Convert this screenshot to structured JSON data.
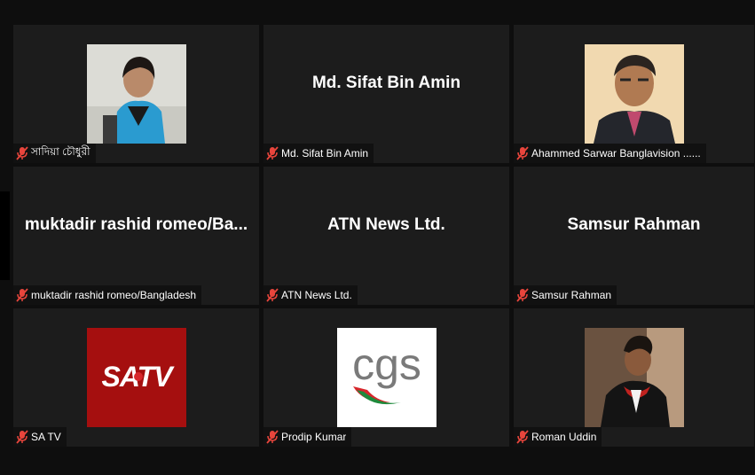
{
  "participants": [
    {
      "display": "",
      "label": "সাদিয়া চৌধুরী",
      "avatar": "photo-woman"
    },
    {
      "display": "Md. Sifat Bin Amin",
      "label": "Md. Sifat Bin Amin",
      "avatar": ""
    },
    {
      "display": "",
      "label": "Ahammed Sarwar Banglavision ......",
      "avatar": "photo-man"
    },
    {
      "display": "muktadir rashid romeo/Ba...",
      "label": "muktadir rashid romeo/Bangladesh",
      "avatar": ""
    },
    {
      "display": "ATN News Ltd.",
      "label": "ATN News Ltd.",
      "avatar": ""
    },
    {
      "display": "Samsur Rahman",
      "label": "Samsur Rahman",
      "avatar": ""
    },
    {
      "display": "",
      "label": "SA TV",
      "avatar": "satv-logo",
      "logo_text": "SATV"
    },
    {
      "display": "",
      "label": "Prodip Kumar",
      "avatar": "cgs-logo",
      "logo_text": "cgs"
    },
    {
      "display": "",
      "label": "Roman Uddin",
      "avatar": "photo-graduate"
    }
  ],
  "icons": {
    "muted": "mic-muted-icon"
  },
  "colors": {
    "muted": "#e8453c",
    "satv_bg": "#a50f0f",
    "cgs_red": "#d7262b",
    "cgs_green": "#1f8a3c"
  }
}
